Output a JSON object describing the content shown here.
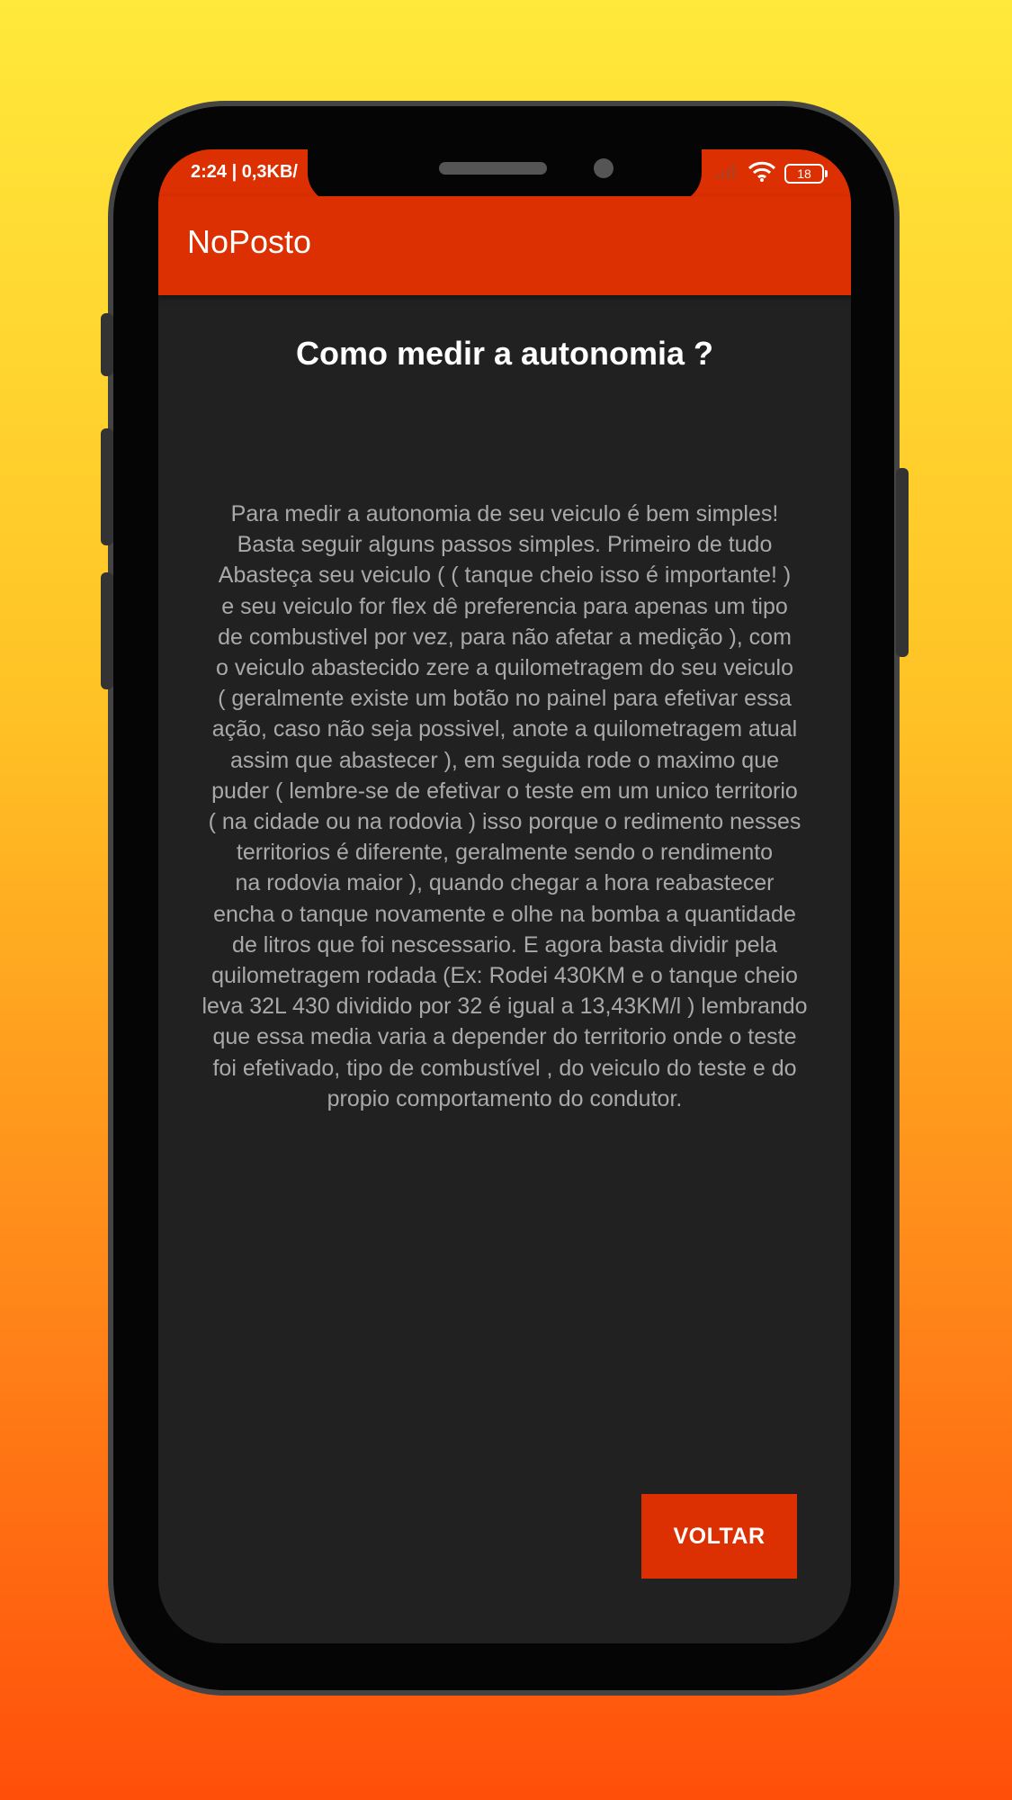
{
  "status_bar": {
    "time": "2:24 | 0,3KB/",
    "battery": "18",
    "icons": [
      "signal-icon",
      "wifi-icon",
      "battery-icon"
    ]
  },
  "app_bar": {
    "title": "NoPosto"
  },
  "content": {
    "heading": "Como medir a autonomia ?",
    "body": "Para medir a autonomia de seu veiculo é bem simples!\nBasta seguir alguns passos simples. Primeiro de tudo\nAbasteça seu veiculo ( ( tanque cheio isso é importante! )\ne seu veiculo for flex dê preferencia para apenas um tipo\nde combustivel por vez, para não afetar a medição ), com\no veiculo abastecido zere a quilometragem do seu veiculo\n( geralmente existe um botão no painel para efetivar essa\nação, caso não seja possivel, anote a quilometragem atual\nassim que abastecer ), em seguida rode o maximo que\npuder ( lembre-se de efetivar o teste em um unico territorio\n( na cidade ou na rodovia ) isso porque o redimento nesses\nterritorios é diferente, geralmente sendo o rendimento\nna rodovia maior ), quando chegar a hora reabastecer\nencha o tanque novamente e olhe na bomba a quantidade\nde litros que foi nescessario. E agora basta dividir pela\nquilometragem rodada (Ex: Rodei 430KM e o tanque cheio\nleva 32L 430 dividido por 32 é igual a 13,43KM/l ) lembrando\nque essa media varia a depender do territorio onde o teste\nfoi efetivado, tipo de combustível , do veiculo do teste e do\npropio comportamento do condutor."
  },
  "actions": {
    "back_label": "VOLTAR"
  },
  "colors": {
    "accent": "#dc2f02",
    "screen_background": "#212121",
    "body_text": "#a9a9a9",
    "page_gradient_top": "#ffe93a",
    "page_gradient_bottom": "#ff4f0a"
  }
}
